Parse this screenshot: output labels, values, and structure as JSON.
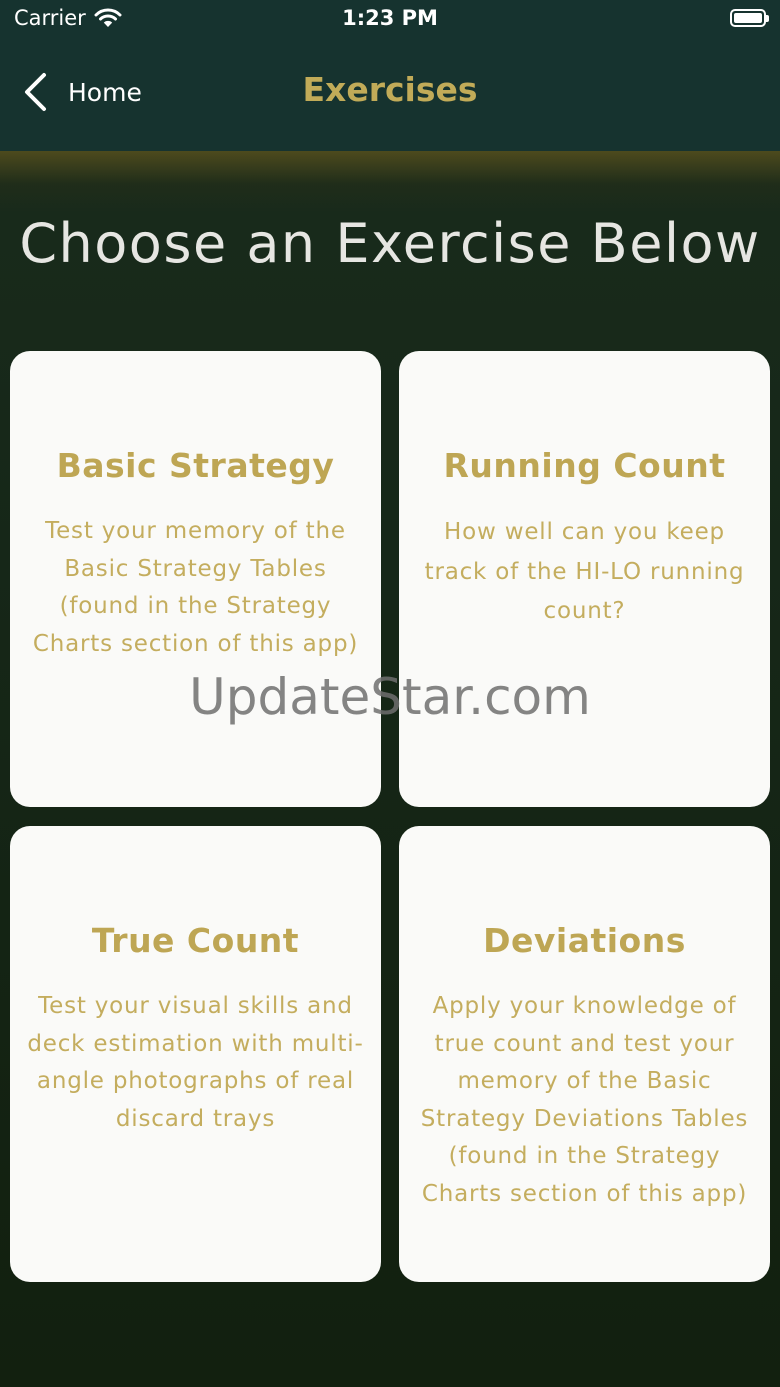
{
  "status_bar": {
    "carrier": "Carrier",
    "time": "1:23 PM"
  },
  "nav": {
    "back_label": "Home",
    "title": "Exercises"
  },
  "heading": "Choose an Exercise Below",
  "cards": [
    {
      "title": "Basic Strategy",
      "description": "Test your memory of the Basic Strategy Tables (found in the Strategy Charts section of this app)"
    },
    {
      "title": "Running Count",
      "description": "How well can you keep track of the HI-LO running count?"
    },
    {
      "title": "True Count",
      "description": "Test your visual skills and deck estimation with multi-angle photographs of real discard trays"
    },
    {
      "title": "Deviations",
      "description": "Apply your knowledge of true count and test your memory of the Basic Strategy Deviations Tables (found in the Strategy Charts section of this app)"
    }
  ],
  "watermark": "UpdateStar.com",
  "colors": {
    "nav_background": "#16332f",
    "accent_gold": "#c1ab58",
    "card_background": "#fafaf8",
    "screen_background": "#142418"
  },
  "icons": {
    "back": "chevron-left-icon",
    "wifi": "wifi-icon",
    "battery": "battery-icon"
  }
}
